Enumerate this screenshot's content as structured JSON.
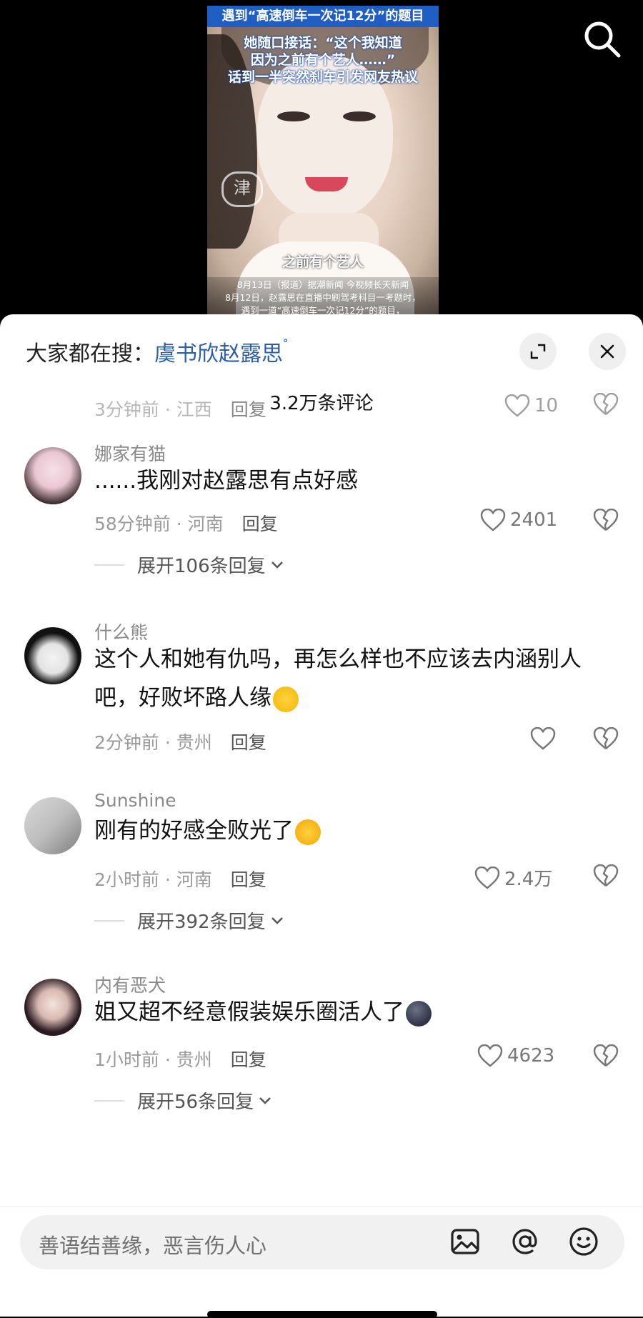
{
  "video": {
    "banner": "遇到“高速倒车一次记12分”的题目",
    "headline": [
      "她随口接话：“这个我知道",
      "因为之前有个艺人……”",
      "话到一半突然刹车引发网友热议"
    ],
    "subtitle": "之前有个艺人",
    "news": [
      "8月13日（报道）据潮新闻 今视频长天新闻",
      "8月12日，赵露思在直播中刷驾考科目一考题时，",
      "遇到一道“高速倒车一次记12分”的题目，"
    ],
    "watermark": "津"
  },
  "search_bar": {
    "prefix": "大家都在搜：",
    "keyword": "虞书欣赵露思",
    "search_glyph": "ᐤ"
  },
  "comments_count": "3.2万条评论",
  "comments": [
    {
      "time": "3分钟前 · 江西",
      "reply": "回复",
      "likes": "10"
    },
    {
      "username": "娜家有猫",
      "text": "......我刚对赵露思有点好感",
      "time": "58分钟前 · 河南",
      "reply": "回复",
      "likes": "2401",
      "expand": "展开106条回复"
    },
    {
      "username": "什么熊",
      "text_line1": "这个人和她有仇吗，再怎么样也不应该去内涵别人",
      "text_line2": "吧，好败坏路人缘",
      "time": "2分钟前 · 贵州",
      "reply": "回复",
      "likes": ""
    },
    {
      "username": "Sunshine",
      "text": "刚有的好感全败光了",
      "time": "2小时前 · 河南",
      "reply": "回复",
      "likes": "2.4万",
      "expand": "展开392条回复"
    },
    {
      "username": "内有恶犬",
      "text": "姐又超不经意假装娱乐圈活人了",
      "time": "1小时前 · 贵州",
      "reply": "回复",
      "likes": "4623",
      "expand": "展开56条回复"
    }
  ],
  "input": {
    "placeholder": "善语结善缘，恶言伤人心"
  },
  "colors": {
    "keyword": "#2c5fa8",
    "banner": "#1f5fc4"
  }
}
